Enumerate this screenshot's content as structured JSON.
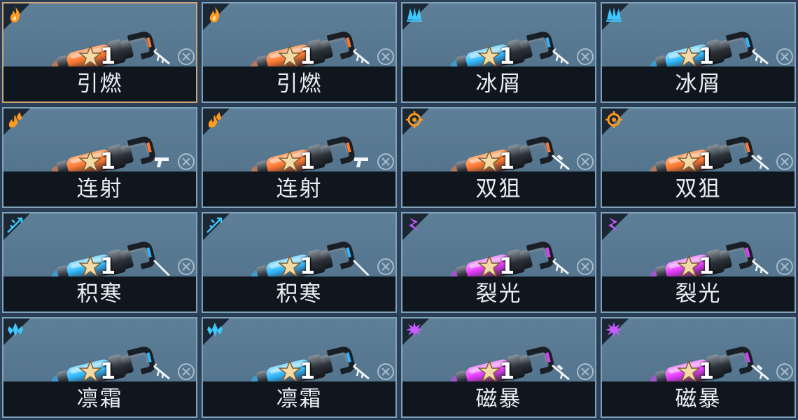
{
  "cards": [
    {
      "name": "引燃",
      "level": "1",
      "element": "fire",
      "weapon": "rifle",
      "glow": "#ff7a33",
      "core": "#ffb07a",
      "icon_color": "#ff9a1e",
      "selected": true
    },
    {
      "name": "引燃",
      "level": "1",
      "element": "fire",
      "weapon": "rifle",
      "glow": "#ff7a33",
      "core": "#ffb07a",
      "icon_color": "#ff9a1e",
      "selected": false
    },
    {
      "name": "冰屑",
      "level": "1",
      "element": "frost",
      "weapon": "rifle",
      "glow": "#2fb8ff",
      "core": "#9be4ff",
      "icon_color": "#3fc7ff",
      "selected": false
    },
    {
      "name": "冰屑",
      "level": "1",
      "element": "frost",
      "weapon": "rifle",
      "glow": "#2fb8ff",
      "core": "#9be4ff",
      "icon_color": "#3fc7ff",
      "selected": false
    },
    {
      "name": "连射",
      "level": "1",
      "element": "fire-burst",
      "weapon": "pistol",
      "glow": "#ff7a33",
      "core": "#ffb07a",
      "icon_color": "#ff9a1e",
      "selected": false
    },
    {
      "name": "连射",
      "level": "1",
      "element": "fire-burst",
      "weapon": "pistol",
      "glow": "#ff7a33",
      "core": "#ffb07a",
      "icon_color": "#ff9a1e",
      "selected": false
    },
    {
      "name": "双狙",
      "level": "1",
      "element": "target",
      "weapon": "sniper",
      "glow": "#ff7a33",
      "core": "#ffb07a",
      "icon_color": "#ff9a1e",
      "selected": false
    },
    {
      "name": "双狙",
      "level": "1",
      "element": "target",
      "weapon": "sniper",
      "glow": "#ff7a33",
      "core": "#ffb07a",
      "icon_color": "#ff9a1e",
      "selected": false
    },
    {
      "name": "积寒",
      "level": "1",
      "element": "frost-spike",
      "weapon": "knife",
      "glow": "#2fb8ff",
      "core": "#9be4ff",
      "icon_color": "#3fc7ff",
      "selected": false
    },
    {
      "name": "积寒",
      "level": "1",
      "element": "frost-spike",
      "weapon": "knife",
      "glow": "#2fb8ff",
      "core": "#9be4ff",
      "icon_color": "#3fc7ff",
      "selected": false
    },
    {
      "name": "裂光",
      "level": "1",
      "element": "lightning",
      "weapon": "rifle",
      "glow": "#e43cff",
      "core": "#f8a8ff",
      "icon_color": "#c65bff",
      "selected": false
    },
    {
      "name": "裂光",
      "level": "1",
      "element": "lightning",
      "weapon": "rifle",
      "glow": "#e43cff",
      "core": "#f8a8ff",
      "icon_color": "#c65bff",
      "selected": false
    },
    {
      "name": "凛霜",
      "level": "1",
      "element": "frost-crystal",
      "weapon": "rifle",
      "glow": "#2fb8ff",
      "core": "#9be4ff",
      "icon_color": "#3fc7ff",
      "selected": false
    },
    {
      "name": "凛霜",
      "level": "1",
      "element": "frost-crystal",
      "weapon": "rifle",
      "glow": "#2fb8ff",
      "core": "#9be4ff",
      "icon_color": "#3fc7ff",
      "selected": false
    },
    {
      "name": "磁暴",
      "level": "1",
      "element": "magnetic",
      "weapon": "sniper",
      "glow": "#e43cff",
      "core": "#f8a8ff",
      "icon_color": "#c65bff",
      "selected": false
    },
    {
      "name": "磁暴",
      "level": "1",
      "element": "magnetic",
      "weapon": "sniper",
      "glow": "#e43cff",
      "core": "#f8a8ff",
      "icon_color": "#c65bff",
      "selected": false
    }
  ]
}
